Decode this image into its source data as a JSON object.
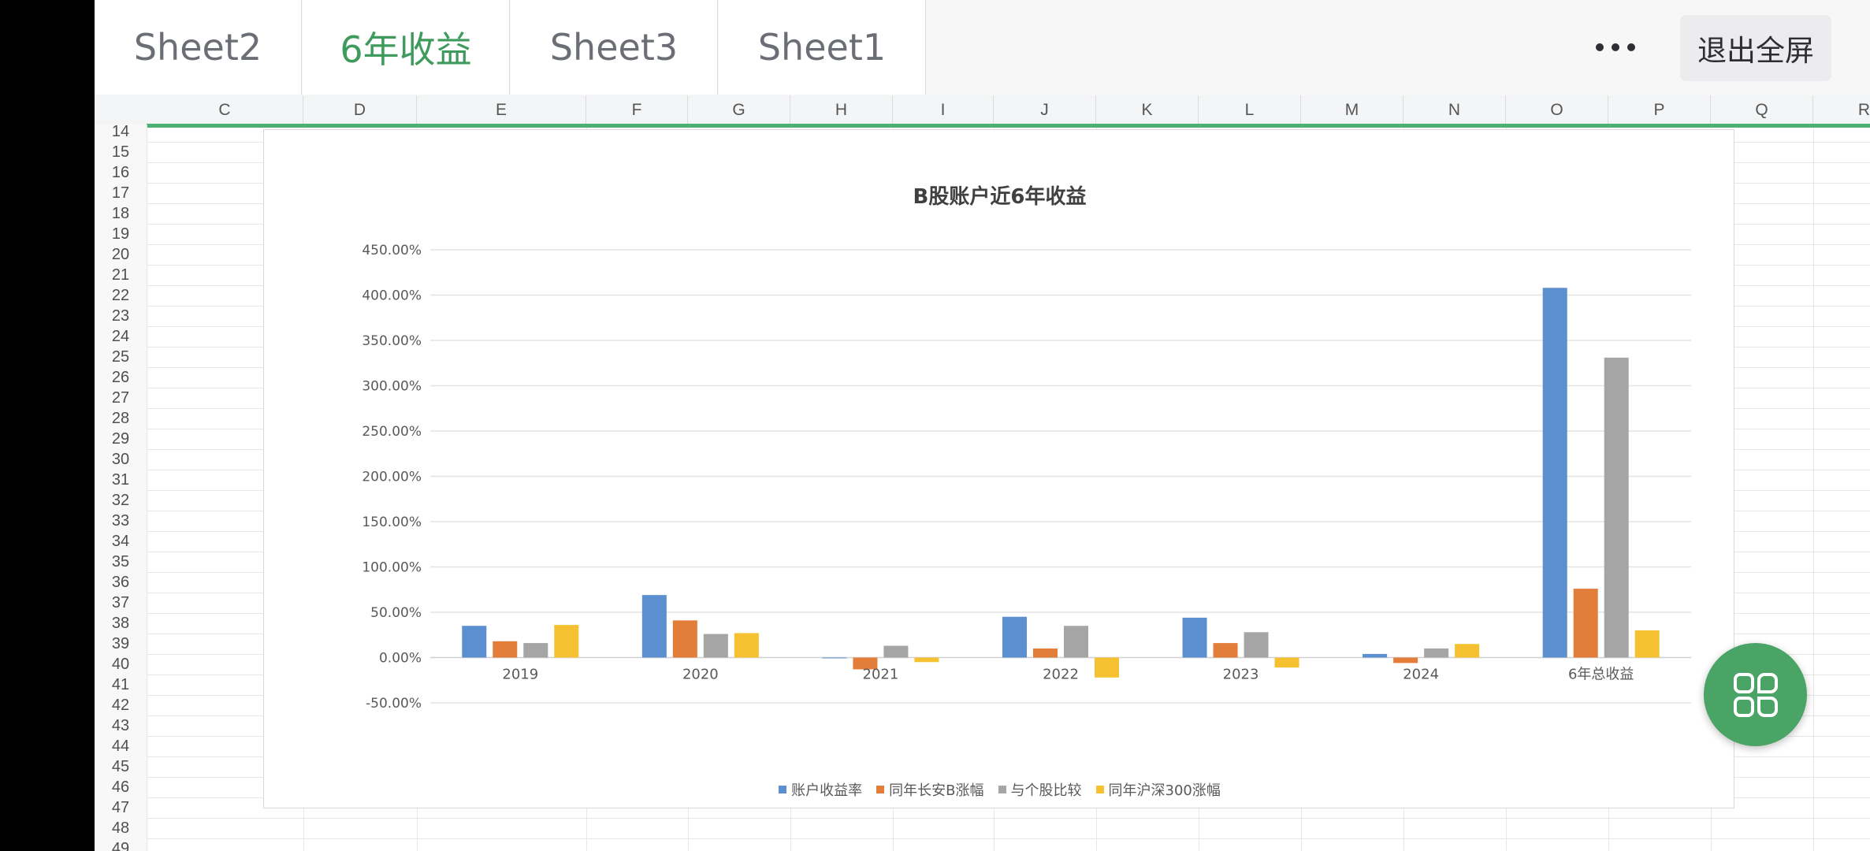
{
  "tabs": [
    "Sheet2",
    "6年收益",
    "Sheet3",
    "Sheet1"
  ],
  "active_tab": "6年收益",
  "toolbar": {
    "more_icon": "more-dots-icon",
    "exit_fullscreen_label": "退出全屏"
  },
  "columns": [
    "C",
    "D",
    "E",
    "F",
    "G",
    "H",
    "I",
    "J",
    "K",
    "L",
    "M",
    "N",
    "O",
    "P",
    "Q",
    "R"
  ],
  "rows": [
    "14",
    "15",
    "16",
    "17",
    "18",
    "19",
    "20",
    "21",
    "22",
    "23",
    "24",
    "25",
    "26",
    "27",
    "28",
    "29",
    "30",
    "31",
    "32",
    "33",
    "34",
    "35",
    "36",
    "37",
    "38",
    "39",
    "40",
    "41",
    "42",
    "43",
    "44",
    "45",
    "46",
    "47",
    "48",
    "49"
  ],
  "fab": {
    "icon": "apps-grid-icon",
    "color": "#4aa466"
  },
  "colors": {
    "accent": "#3e9b5c",
    "selection": "#4caf73"
  },
  "chart_data": {
    "type": "bar",
    "title": "B股账户近6年收益",
    "categories": [
      "2019",
      "2020",
      "2021",
      "2022",
      "2023",
      "2024",
      "6年总收益"
    ],
    "series": [
      {
        "name": "账户收益率",
        "color": "#5b8fd0",
        "values": [
          35,
          69,
          0,
          45,
          44,
          4,
          408
        ]
      },
      {
        "name": "同年长安B涨幅",
        "color": "#e37d3a",
        "values": [
          18,
          41,
          -13,
          10,
          16,
          -6,
          76
        ]
      },
      {
        "name": "与个股比较",
        "color": "#a5a5a5",
        "values": [
          16,
          26,
          13,
          35,
          28,
          10,
          331
        ]
      },
      {
        "name": "同年沪深300涨幅",
        "color": "#f5c130",
        "values": [
          36,
          27,
          -5,
          -22,
          -11,
          15,
          30
        ]
      }
    ],
    "y_ticks": [
      "450.00%",
      "400.00%",
      "350.00%",
      "300.00%",
      "250.00%",
      "200.00%",
      "150.00%",
      "100.00%",
      "50.00%",
      "0.00%",
      "-50.00%"
    ],
    "ylim": [
      -50,
      450
    ],
    "grid": true,
    "legend_position": "bottom"
  }
}
